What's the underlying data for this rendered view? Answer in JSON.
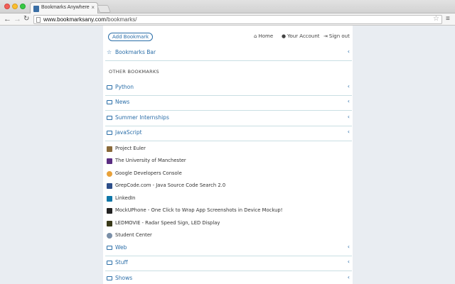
{
  "browser": {
    "tab_title": "Bookmarks Anywhere",
    "tab_close": "×",
    "url_domain": "www.bookmarksany.com",
    "url_path": "/bookmarks/"
  },
  "header": {
    "add_button": "Add Bookmark",
    "nav": [
      {
        "label": "Home",
        "icon": "home-icon"
      },
      {
        "label": "Your Account",
        "icon": "user-icon"
      },
      {
        "label": "Sign out",
        "icon": "sign-out-icon"
      }
    ]
  },
  "bookmarks_bar": {
    "label": "Bookmarks Bar"
  },
  "other_bookmarks": {
    "title": "OTHER BOOKMARKS",
    "folders_top": [
      {
        "label": "Python"
      },
      {
        "label": "News"
      },
      {
        "label": "Summer Internships"
      },
      {
        "label": "JavaScript"
      }
    ],
    "links": [
      {
        "label": "Project Euler",
        "color": "#8a6a3a"
      },
      {
        "label": "The University of Manchester",
        "color": "#5a2d82"
      },
      {
        "label": "Google Developers Console",
        "color": "#e8a13a"
      },
      {
        "label": "GrepCode.com - Java Source Code Search 2.0",
        "color": "#2d4f8a"
      },
      {
        "label": "LinkedIn",
        "color": "#0e76a8"
      },
      {
        "label": "MockUPhone - One Click to Wrap App Screenshots in Device Mockup!",
        "color": "#222222"
      },
      {
        "label": "LEDMOVIE - Radar Speed Sign, LED Display",
        "color": "#3a3a1a"
      },
      {
        "label": "Student Center",
        "color": "#7a8fa8"
      }
    ],
    "folders_bottom": [
      {
        "label": "Web"
      },
      {
        "label": "Stuff"
      },
      {
        "label": "Shows"
      }
    ]
  },
  "colors": {
    "accent": "#2b6ea8",
    "divider": "#c9dfe3",
    "background": "#e9edf2"
  }
}
